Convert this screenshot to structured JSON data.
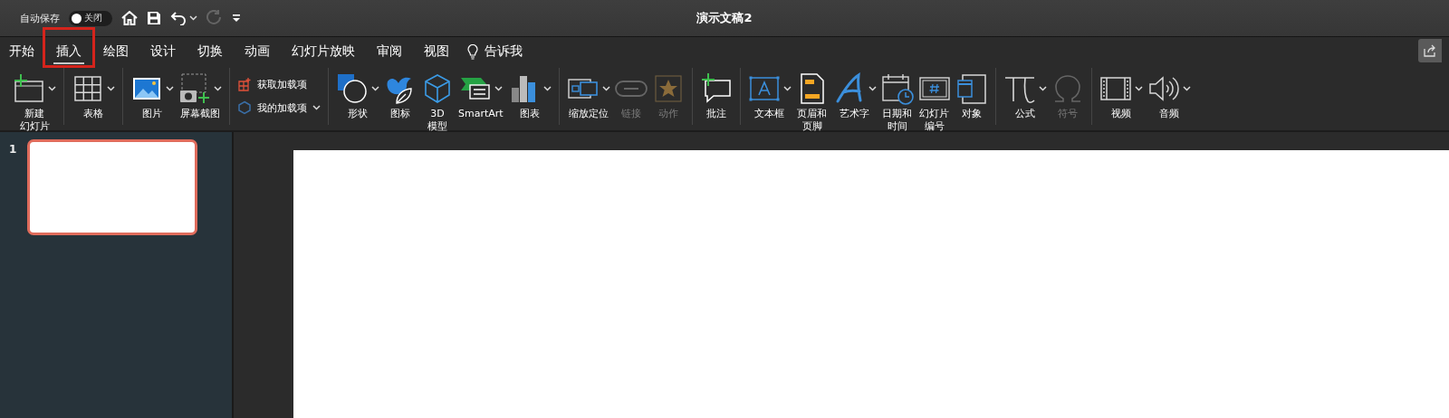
{
  "quick_access": {
    "autosave_label": "自动保存",
    "autosave_toggle": {
      "on": false,
      "label": "关闭"
    },
    "buttons": [
      {
        "kind": "home",
        "dropdown": false,
        "disabled": false
      },
      {
        "kind": "save",
        "dropdown": false,
        "disabled": false
      },
      {
        "kind": "undo",
        "dropdown": true,
        "disabled": false
      },
      {
        "kind": "redo",
        "dropdown": false,
        "disabled": true
      },
      {
        "kind": "customize",
        "dropdown": false,
        "disabled": false
      }
    ]
  },
  "window": {
    "title": "演示文稿2"
  },
  "tabs": [
    {
      "label": "开始",
      "selected": false,
      "highlighted": false
    },
    {
      "label": "插入",
      "selected": true,
      "highlighted": true
    },
    {
      "label": "绘图",
      "selected": false,
      "highlighted": false
    },
    {
      "label": "设计",
      "selected": false,
      "highlighted": false
    },
    {
      "label": "切换",
      "selected": false,
      "highlighted": false
    },
    {
      "label": "动画",
      "selected": false,
      "highlighted": false
    },
    {
      "label": "幻灯片放映",
      "selected": false,
      "highlighted": false
    },
    {
      "label": "审阅",
      "selected": false,
      "highlighted": false
    },
    {
      "label": "视图",
      "selected": false,
      "highlighted": false
    }
  ],
  "tell_me": {
    "label": "告诉我"
  },
  "ribbon": {
    "groups": [
      {
        "items": [
          {
            "kind": "large",
            "label": "新建幻灯片",
            "dropdown": true,
            "disabled": false
          }
        ]
      },
      {
        "items": [
          {
            "kind": "large",
            "label": "表格",
            "dropdown": true,
            "disabled": false
          }
        ]
      },
      {
        "items": [
          {
            "kind": "large",
            "label": "图片",
            "dropdown": true,
            "disabled": false
          },
          {
            "kind": "large",
            "label": "屏幕截图",
            "dropdown": true,
            "disabled": false
          }
        ]
      },
      {
        "items": [
          {
            "kind": "small",
            "label": "获取加载项",
            "dropdown": false,
            "disabled": false
          },
          {
            "kind": "small",
            "label": "我的加载项",
            "dropdown": true,
            "disabled": false
          }
        ]
      },
      {
        "items": [
          {
            "kind": "large",
            "label": "形状",
            "dropdown": true,
            "disabled": false
          },
          {
            "kind": "large",
            "label": "图标",
            "dropdown": false,
            "disabled": false
          },
          {
            "kind": "large",
            "label": "3D模型",
            "dropdown": false,
            "disabled": false
          },
          {
            "kind": "large",
            "label": "SmartArt",
            "dropdown": true,
            "disabled": false
          },
          {
            "kind": "large",
            "label": "图表",
            "dropdown": true,
            "disabled": false
          }
        ]
      },
      {
        "items": [
          {
            "kind": "large",
            "label": "缩放定位",
            "dropdown": true,
            "disabled": false
          },
          {
            "kind": "large",
            "label": "链接",
            "dropdown": false,
            "disabled": true
          },
          {
            "kind": "large",
            "label": "动作",
            "dropdown": false,
            "disabled": true
          }
        ]
      },
      {
        "items": [
          {
            "kind": "large",
            "label": "批注",
            "dropdown": false,
            "disabled": false
          }
        ]
      },
      {
        "items": [
          {
            "kind": "large",
            "label": "文本框",
            "dropdown": true,
            "disabled": false
          },
          {
            "kind": "large",
            "label": "页眉和页脚",
            "dropdown": false,
            "disabled": false
          },
          {
            "kind": "large",
            "label": "艺术字",
            "dropdown": true,
            "disabled": false
          },
          {
            "kind": "large",
            "label": "日期和时间",
            "dropdown": false,
            "disabled": false
          },
          {
            "kind": "large",
            "label": "幻灯片编号",
            "dropdown": false,
            "disabled": false
          },
          {
            "kind": "large",
            "label": "对象",
            "dropdown": false,
            "disabled": false
          }
        ]
      },
      {
        "items": [
          {
            "kind": "large",
            "label": "公式",
            "dropdown": true,
            "disabled": false
          },
          {
            "kind": "large",
            "label": "符号",
            "dropdown": false,
            "disabled": true
          }
        ]
      },
      {
        "items": [
          {
            "kind": "large",
            "label": "视频",
            "dropdown": true,
            "disabled": false
          },
          {
            "kind": "large",
            "label": "音频",
            "dropdown": true,
            "disabled": false
          }
        ]
      }
    ]
  },
  "slides_pane": {
    "thumbnails": [
      {
        "number": "1",
        "selected": true
      }
    ]
  }
}
